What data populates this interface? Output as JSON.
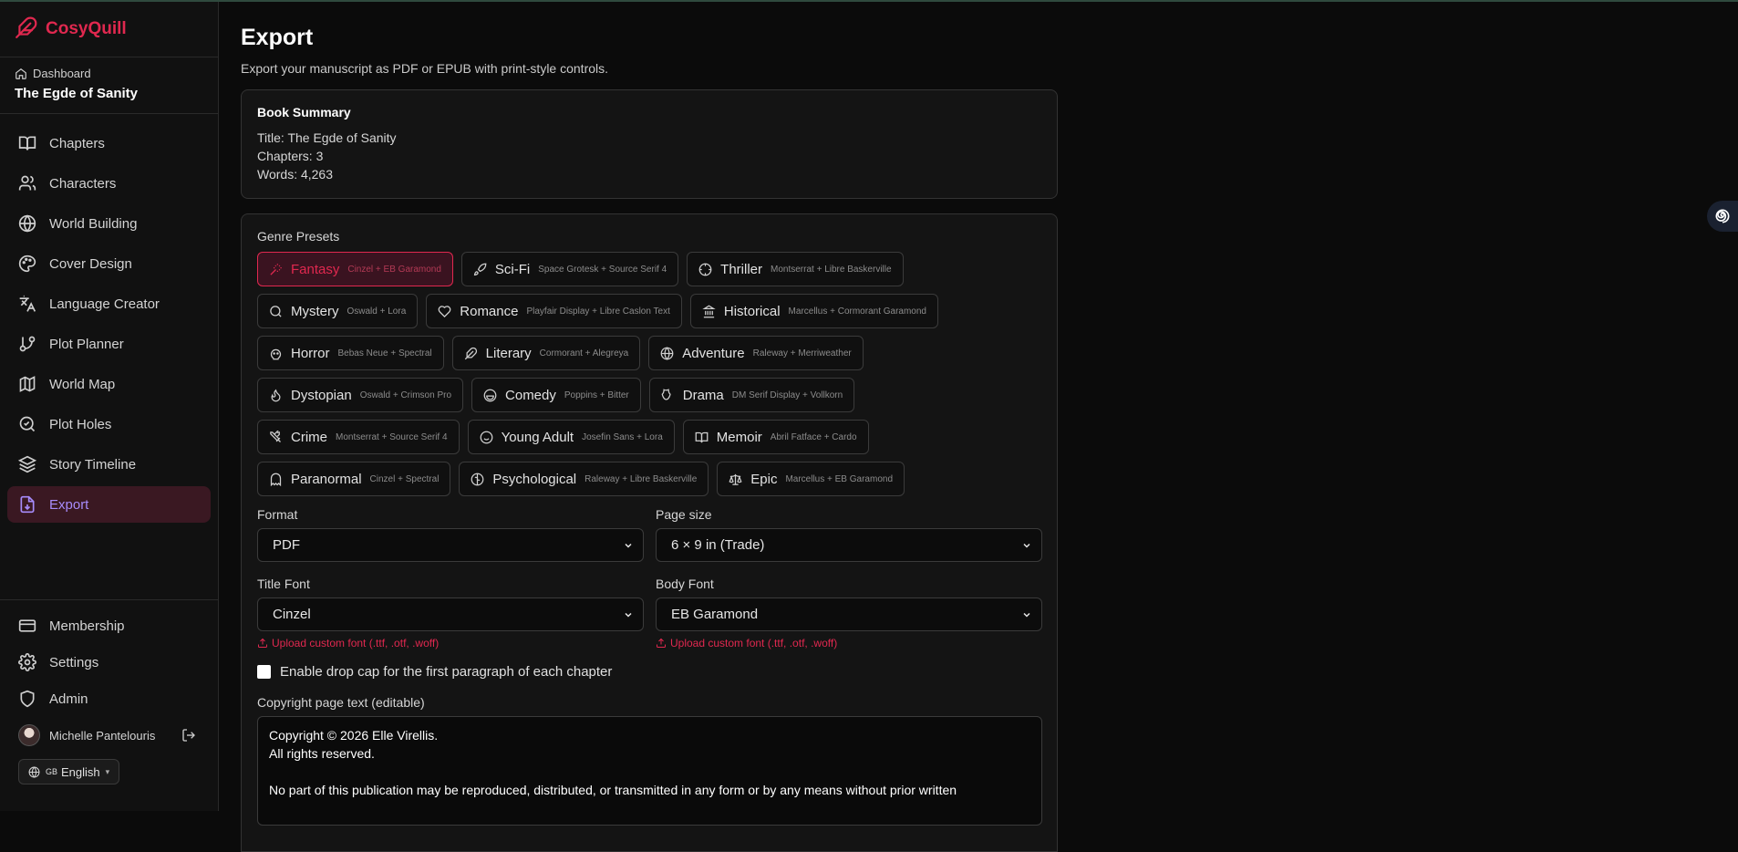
{
  "app": {
    "name": "CosyQuill",
    "accent": "#e0284f",
    "active_color": "#a78bfa"
  },
  "project": {
    "crumb": "Dashboard",
    "title": "The Egde of Sanity"
  },
  "nav": [
    {
      "label": "Chapters",
      "icon": "book-open-icon"
    },
    {
      "label": "Characters",
      "icon": "users-icon"
    },
    {
      "label": "World Building",
      "icon": "globe-icon"
    },
    {
      "label": "Cover Design",
      "icon": "palette-icon"
    },
    {
      "label": "Language Creator",
      "icon": "languages-icon"
    },
    {
      "label": "Plot Planner",
      "icon": "git-branch-icon"
    },
    {
      "label": "World Map",
      "icon": "map-icon"
    },
    {
      "label": "Plot Holes",
      "icon": "search-check-icon"
    },
    {
      "label": "Story Timeline",
      "icon": "layers-icon"
    },
    {
      "label": "Export",
      "icon": "file-export-icon",
      "active": true
    }
  ],
  "bottom": {
    "membership": "Membership",
    "settings": "Settings",
    "admin": "Admin",
    "user": "Michelle Pantelouris",
    "language": "English",
    "language_code": "GB"
  },
  "page": {
    "title": "Export",
    "subtitle": "Export your manuscript as PDF or EPUB with print-style controls."
  },
  "summary": {
    "heading": "Book Summary",
    "title_line": "Title: The Egde of Sanity",
    "chapters_line": "Chapters: 3",
    "words_line": "Words: 4,263"
  },
  "presets": {
    "label": "Genre Presets",
    "rows": [
      [
        {
          "name": "Fantasy",
          "fonts": "Cinzel + EB Garamond",
          "icon": "wand-icon",
          "selected": true
        },
        {
          "name": "Sci-Fi",
          "fonts": "Space Grotesk + Source Serif 4",
          "icon": "rocket-icon"
        },
        {
          "name": "Thriller",
          "fonts": "Montserrat + Libre Baskerville",
          "icon": "crosshair-icon"
        }
      ],
      [
        {
          "name": "Mystery",
          "fonts": "Oswald + Lora",
          "icon": "search-icon"
        },
        {
          "name": "Romance",
          "fonts": "Playfair Display + Libre Caslon Text",
          "icon": "heart-icon"
        },
        {
          "name": "Historical",
          "fonts": "Marcellus + Cormorant Garamond",
          "icon": "landmark-icon"
        }
      ],
      [
        {
          "name": "Horror",
          "fonts": "Bebas Neue + Spectral",
          "icon": "skull-icon"
        },
        {
          "name": "Literary",
          "fonts": "Cormorant + Alegreya",
          "icon": "feather-icon"
        },
        {
          "name": "Adventure",
          "fonts": "Raleway + Merriweather",
          "icon": "globe-icon"
        }
      ],
      [
        {
          "name": "Dystopian",
          "fonts": "Oswald + Crimson Pro",
          "icon": "flame-icon"
        },
        {
          "name": "Comedy",
          "fonts": "Poppins + Bitter",
          "icon": "laugh-icon"
        },
        {
          "name": "Drama",
          "fonts": "DM Serif Display + Vollkorn",
          "icon": "drama-icon"
        }
      ],
      [
        {
          "name": "Crime",
          "fonts": "Montserrat + Source Serif 4",
          "icon": "swords-icon"
        },
        {
          "name": "Young Adult",
          "fonts": "Josefin Sans + Lora",
          "icon": "smile-icon"
        },
        {
          "name": "Memoir",
          "fonts": "Abril Fatface + Cardo",
          "icon": "book-open-icon"
        }
      ],
      [
        {
          "name": "Paranormal",
          "fonts": "Cinzel + Spectral",
          "icon": "ghost-icon"
        },
        {
          "name": "Psychological",
          "fonts": "Raleway + Libre Baskerville",
          "icon": "brain-icon"
        },
        {
          "name": "Epic",
          "fonts": "Marcellus + EB Garamond",
          "icon": "scale-icon"
        }
      ]
    ]
  },
  "form": {
    "format_label": "Format",
    "format_value": "PDF",
    "page_size_label": "Page size",
    "page_size_value": "6 × 9 in (Trade)",
    "title_font_label": "Title Font",
    "title_font_value": "Cinzel",
    "body_font_label": "Body Font",
    "body_font_value": "EB Garamond",
    "upload_label": "Upload custom font (.ttf, .otf, .woff)",
    "drop_cap_label": "Enable drop cap for the first paragraph of each chapter",
    "copyright_label": "Copyright page text (editable)",
    "copyright_text": "Copyright © 2026 Elle Virellis.\nAll rights reserved.\n\nNo part of this publication may be reproduced, distributed, or transmitted in any form or by any means without prior written"
  }
}
